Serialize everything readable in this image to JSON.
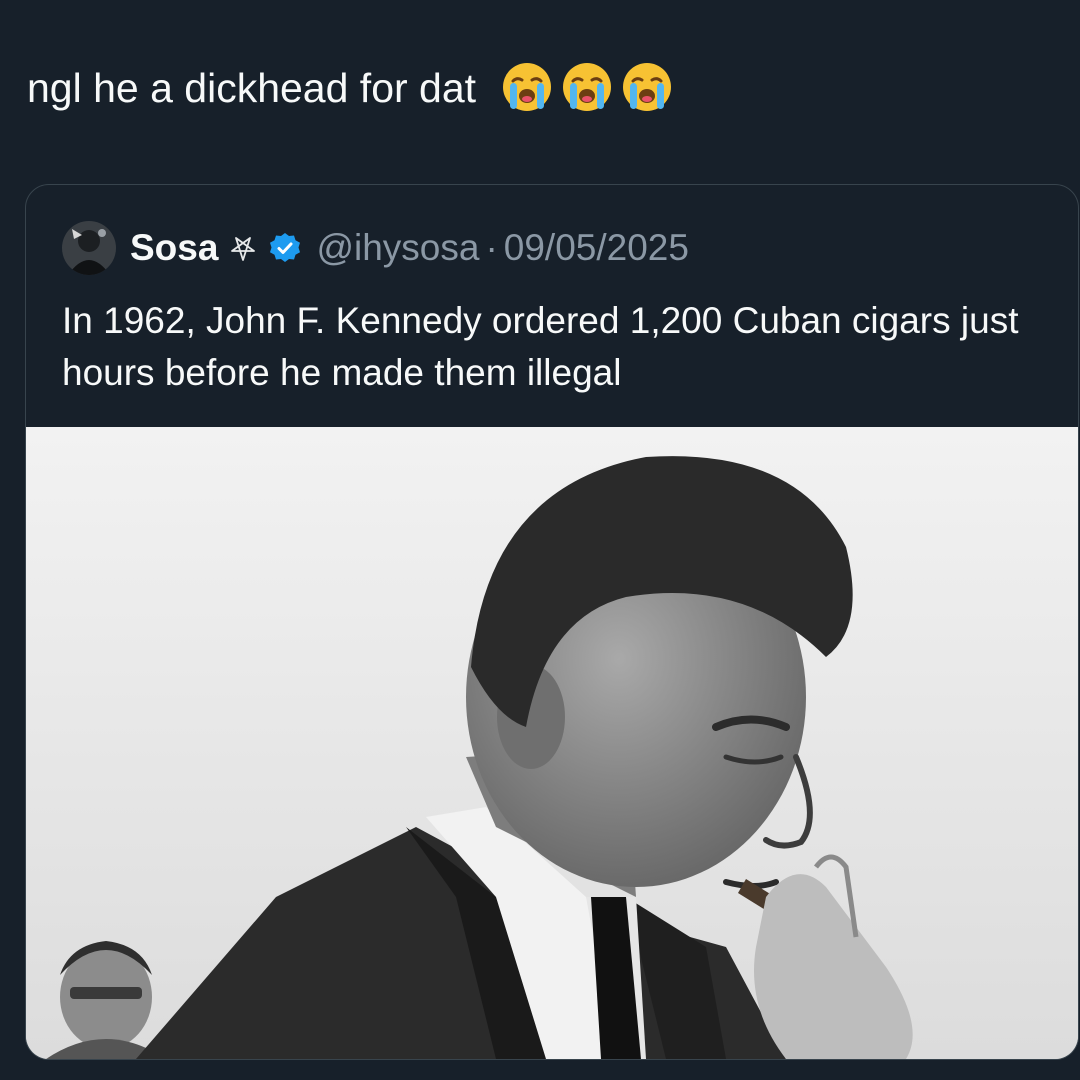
{
  "post": {
    "text": "ngl he a dickhead for dat",
    "emojis": [
      "loudly-crying-face-icon",
      "loudly-crying-face-icon",
      "loudly-crying-face-icon"
    ]
  },
  "quoted_post": {
    "author_name": "Sosa",
    "name_icon": "pentagram-icon",
    "verified_icon": "verified-badge-icon",
    "verified_color": "#1d9bf0",
    "handle": "@ihysosa",
    "separator": "·",
    "date": "09/05/2025",
    "text": "In 1962, John F. Kennedy ordered 1,200 Cuban cigars just hours before he made them illegal",
    "media": "black-and-white-photo-man-smoking-cigar"
  },
  "colors": {
    "background": "#17202a",
    "border": "#38444d",
    "secondary_text": "#8b98a5",
    "primary_text": "#f7f9f9"
  }
}
